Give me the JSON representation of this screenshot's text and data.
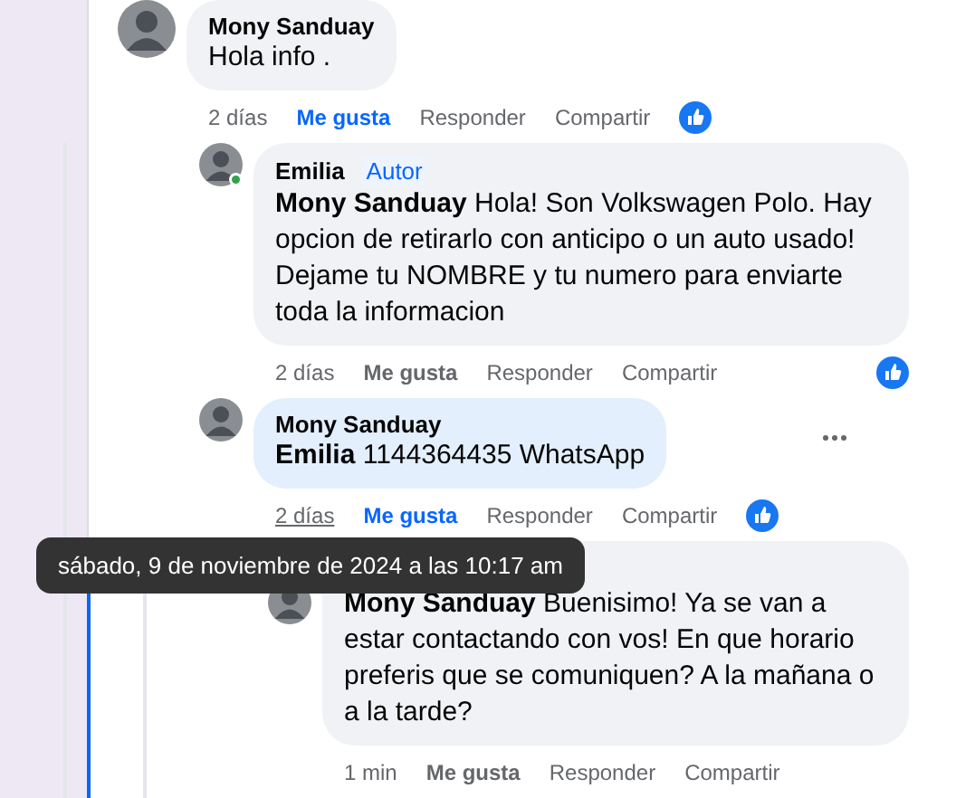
{
  "comments": [
    {
      "author": "Mony Sanduay",
      "text": "Hola info .",
      "time": "2 días",
      "time_hovered": false,
      "actions": [
        "Me gusta",
        "Responder",
        "Compartir"
      ],
      "liked": true,
      "reaction": true,
      "highlighted": false,
      "online": false,
      "more_menu": false,
      "children": [
        {
          "author": "Emilia",
          "badge": "Autor",
          "online": true,
          "text": "**Mony Sanduay** Hola! Son Volkswagen Polo. Hay opcion de retirarlo con anticipo o un auto usado! Dejame tu NOMBRE y tu numero para enviarte toda la informacion",
          "time": "2 días",
          "time_hovered": false,
          "actions": [
            "Me gusta",
            "Responder",
            "Compartir"
          ],
          "liked": false,
          "reaction": true,
          "highlighted": false,
          "more_menu": false
        },
        {
          "author": "Mony Sanduay",
          "text": "**Emilia** 1144364435 WhatsApp",
          "time": "2 días",
          "time_hovered": true,
          "actions": [
            "Me gusta",
            "Responder",
            "Compartir"
          ],
          "liked": true,
          "reaction": true,
          "highlighted": true,
          "online": false,
          "more_menu": true,
          "children": [
            {
              "text": "**Mony Sanduay** Buenisimo! Ya se van a estar contactando con vos! En que horario preferis que se comuniquen? A la mañana o a la tarde?",
              "time": "1 min",
              "time_hovered": false,
              "actions": [
                "Me gusta",
                "Responder",
                "Compartir"
              ],
              "liked": false,
              "reaction": false,
              "highlighted": false,
              "more_menu": false
            }
          ]
        }
      ]
    }
  ],
  "tooltip": {
    "text": "sábado, 9 de noviembre de 2024 a las 10:17 am"
  }
}
